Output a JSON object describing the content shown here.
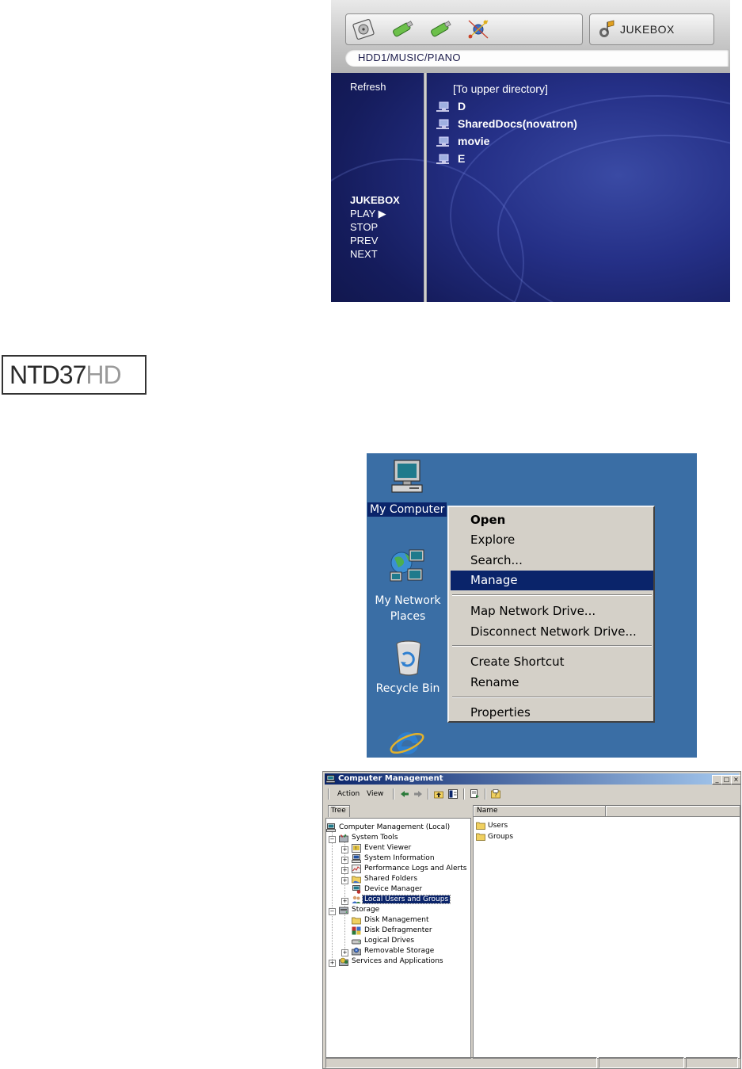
{
  "jukebox": {
    "mode_label": "JUKEBOX",
    "path": "HDD1/MUSIC/PIANO",
    "refresh_label": "Refresh",
    "sidebar": {
      "title": "JUKEBOX",
      "items": [
        "PLAY ▶",
        "STOP",
        "PREV",
        "NEXT"
      ]
    },
    "upper_dir": "[To upper directory]",
    "entries": [
      "D",
      "SharedDocs(novatron)",
      "movie",
      "E"
    ],
    "toolbar_icons": [
      "hdd-icon",
      "usb-stick-icon",
      "usb-stick-icon",
      "network-icon"
    ],
    "colors": {
      "background": "#1e2878",
      "toolbar": "#cfcfcf"
    }
  },
  "logo": {
    "part1": "NTD37",
    "part2": "HD"
  },
  "desktop": {
    "icons": [
      {
        "label": "My Computer",
        "icon": "my-computer-icon"
      },
      {
        "label": "My Network Places",
        "icon": "network-places-icon"
      },
      {
        "label": "Recycle Bin",
        "icon": "recycle-bin-icon"
      },
      {
        "label": "",
        "icon": "internet-explorer-icon"
      }
    ],
    "context_menu": {
      "open": "Open",
      "explore": "Explore",
      "search": "Search...",
      "manage": "Manage",
      "map_drive": "Map Network Drive...",
      "disconnect_drive": "Disconnect Network Drive...",
      "create_shortcut": "Create Shortcut",
      "rename": "Rename",
      "properties": "Properties",
      "selected": "Manage"
    },
    "colors": {
      "background": "#3a6ea5",
      "menu": "#d4d0c8",
      "highlight": "#0a246a"
    }
  },
  "computer_management": {
    "title": "Computer Management",
    "menu": {
      "action": "Action",
      "view": "View"
    },
    "tab": "Tree",
    "tree": {
      "root": "Computer Management (Local)",
      "system_tools": "System Tools",
      "event_viewer": "Event Viewer",
      "system_information": "System Information",
      "perf_logs": "Performance Logs and Alerts",
      "shared_folders": "Shared Folders",
      "device_manager": "Device Manager",
      "local_users": "Local Users and Groups",
      "storage": "Storage",
      "disk_management": "Disk Management",
      "disk_defrag": "Disk Defragmenter",
      "logical_drives": "Logical Drives",
      "removable_storage": "Removable Storage",
      "services": "Services and Applications",
      "selected": "Local Users and Groups"
    },
    "list": {
      "column": "Name",
      "items": [
        "Users",
        "Groups"
      ]
    },
    "window_buttons": {
      "minimize": "_",
      "maximize": "□",
      "close": "×"
    }
  }
}
